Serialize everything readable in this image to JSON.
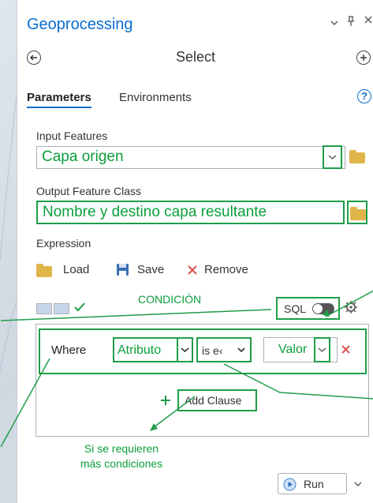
{
  "panel": {
    "title": "Geoprocessing",
    "window_controls": {
      "dropdown": "⌄",
      "pin": "ᵽ",
      "close": "×"
    },
    "back_icon": "←",
    "add_icon": "+",
    "tool_name": "Select",
    "help": "?"
  },
  "tabs": [
    {
      "label": "Parameters",
      "active": true
    },
    {
      "label": "Environments",
      "active": false
    }
  ],
  "params": {
    "input_label": "Input Features",
    "input_value": "Capa origen",
    "output_label": "Output Feature Class",
    "output_value": "Nombre y destino capa resultante",
    "expression_label": "Expression"
  },
  "expression_actions": {
    "load": "Load",
    "save": "Save",
    "remove": "Remove"
  },
  "sql_toggle": {
    "label": "SQL",
    "on": false
  },
  "clause": {
    "where_label": "Where",
    "field": "Atributo",
    "operator": "is e‹",
    "value": "Valor",
    "remove_icon": "×"
  },
  "add_clause": {
    "label": "Add Clause"
  },
  "annotations": {
    "condicion": "CONDICIÓN",
    "more_conditions_line1": "Si se requieren",
    "more_conditions_line2": "más condiciones"
  },
  "run": {
    "label": "Run"
  },
  "colors": {
    "accent_blue": "#0a6ed1",
    "annotation_green": "#1f9d4a",
    "remove_red": "#d9534f"
  }
}
